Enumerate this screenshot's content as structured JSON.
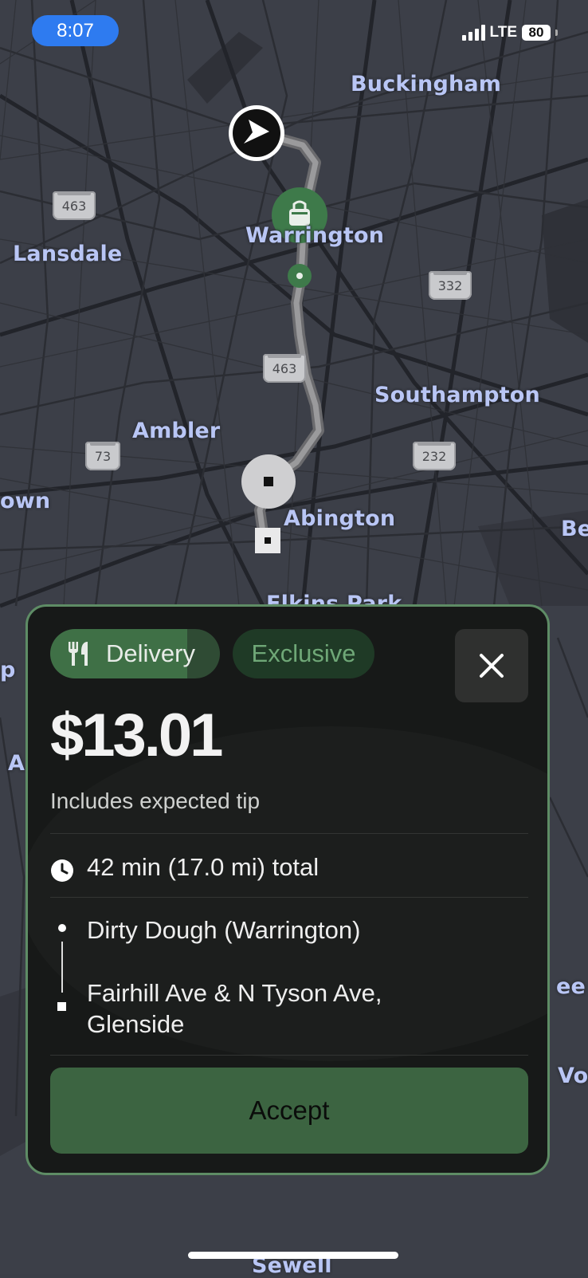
{
  "status_bar": {
    "time": "8:07",
    "network": "LTE",
    "battery": "80"
  },
  "map": {
    "places": {
      "buckingham": "Buckingham",
      "lansdale": "Lansdale",
      "warrington": "Warrington",
      "southampton": "Southampton",
      "ambler": "Ambler",
      "abington": "Abington",
      "town_partial": "own",
      "be_partial": "Be",
      "elkins_partial": "Elkins Park",
      "sewell_partial": "Sewell",
      "ee_partial": "ee",
      "vo_partial": "Vo",
      "p_partial": "p",
      "a_partial": "A"
    },
    "routes": {
      "r463a": "463",
      "r463b": "463",
      "r332": "332",
      "r73": "73",
      "r232": "232"
    },
    "icons": [
      "navigation-arrow-icon",
      "pickup-bag-icon",
      "dropoff-square-icon"
    ]
  },
  "offer": {
    "tag_delivery": "Delivery",
    "tag_exclusive": "Exclusive",
    "price": "$13.01",
    "tip_note": "Includes expected tip",
    "duration": "42 min (17.0 mi) total",
    "pickup": "Dirty Dough (Warrington)",
    "dropoff_line1": "Fairhill Ave & N Tyson Ave,",
    "dropoff_line2": "Glenside",
    "accept_label": "Accept",
    "colors": {
      "accent": "#3c6441",
      "exclusive_text": "#6fa777",
      "card_border": "#5e8c65"
    }
  }
}
